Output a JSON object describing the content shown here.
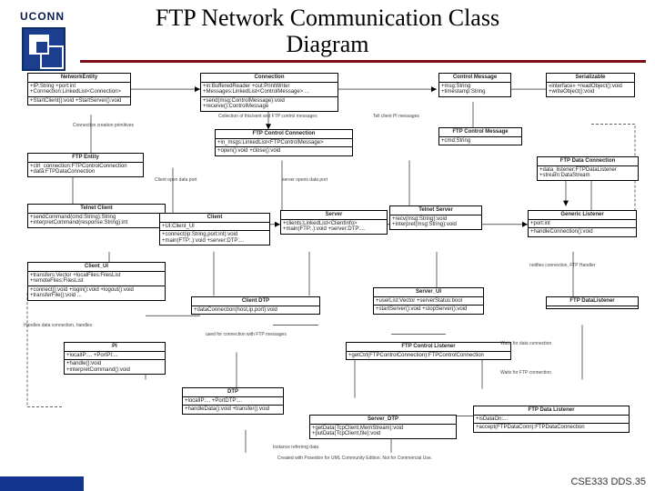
{
  "header": {
    "logo_word": "UCONN",
    "title_l1": "FTP Network Communication Class",
    "title_l2": "Diagram"
  },
  "footer": "CSE333 DDS.35",
  "watermark": "Created with Poseidon for UML Community Edition. Not for Commercial Use.",
  "boxes": {
    "networkentity": {
      "name": "NetworkEntity",
      "a": "+IP:String\n+port:int\n+Connection:LinkedList<Connection>",
      "b": "+StartClient():void\n+StartServer():void"
    },
    "connection": {
      "name": "Connection",
      "a": "+in:BufferedReader\n+out:PrintWriter\n+Messages:LinkedList<ControlMessage>  ...",
      "b": "+send(msg:ControlMessage):void\n+receive():ControlMessage"
    },
    "ctrlmsg": {
      "name": "Control Message",
      "a": "+msg:String\n+timestamp:String"
    },
    "serializable": {
      "name": "Serializable",
      "a": "«interface»\n+readObject():void\n+writeObject():void"
    },
    "ftpentity": {
      "name": "FTP Entity",
      "a": "+ctrl_connection:FTPControlConnection\n+data:FTPDataConnection"
    },
    "ftpcontrolconn": {
      "name": "FTP Control Connection",
      "a": "+in_msgs:LinkedList<FTPControlMessage>",
      "b": "+open():void\n+close():void"
    },
    "ftpctrlmsg": {
      "name": "FTP Control Message",
      "a": "+cmd:String"
    },
    "ftpdataconn": {
      "name": "FTP Data Connection",
      "a": "+data_listener:FTPDataListener\n+stream:DataStream"
    },
    "telnetclient": {
      "name": "Telnet Client",
      "a": "+sendCommand(cmd:String):String\n+interpretCommand(response:String):int"
    },
    "client": {
      "name": "Client",
      "a": "+UI:Client_UI",
      "b": "+connect(ip:String,port:int):void\n+main(FTP:.):void\n+server:DTP:..."
    },
    "server": {
      "name": "Server",
      "a": "+clients:LinkedList<ClientInfo>\n+main(FTP:.):void\n+server:DTP:..."
    },
    "telnetserver": {
      "name": "Telnet Server",
      "a": "+recv(msg:String):void\n+interpret(msg:String):void"
    },
    "genericlistener": {
      "name": "Generic Listener",
      "a": "+port:int",
      "b": "+handleConnection():void"
    },
    "clientui": {
      "name": "Client_UI",
      "a": "+transfers:Vector\n+localFiles:FilesList\n+remoteFiles:FilesList",
      "b": "+connect():void\n+login():void\n+logout():void\n+transferFile():void  ..."
    },
    "clientdtp": {
      "name": "Client DTP",
      "a": "+dataConnection(host,ip,port):void"
    },
    "serverui": {
      "name": "Server_UI",
      "a": "+userList:Vector\n+serverStatus:bool",
      "b": "+startServer():void\n+stopServer():void"
    },
    "ftpctrllistener": {
      "name": "FTP Control Listener",
      "a": "+getCtrl(FTPControlConnection):FTPControlConnection"
    },
    "ftpdatalistener": {
      "name": "FTP DataListener",
      "a": ""
    },
    "pi": {
      "name": "PI",
      "a": "+localIP:...\n+PortPI:...",
      "b": "+handle():void\n+interpretCommand():void"
    },
    "dtp": {
      "name": "DTP",
      "a": "+localIP:...\n+PortDTP:...",
      "b": "+handleData():void\n+transfer():void"
    },
    "serverdtp": {
      "name": "Server_DTP",
      "a": "+getData(TcpClient,MemStream):void\n+putData(TcpClient,file):void"
    },
    "ftpdatacon2": {
      "name": "FTP Data Listener",
      "a": "+isDataOn:...",
      "b": "+accept(FTPDataConn):FTPDataConnection"
    }
  },
  "notes": {
    "n1": "Connection creation primitives",
    "n2": "Collection of this/sent and FTP control messages",
    "n3": "Tell client PI messages",
    "n4": "Client open data port",
    "n5": "server opens data port",
    "n6": "notifies connection, FTP Handler",
    "n7": "Handles data connection, handles",
    "n8": "used for connection with FTP messages",
    "n9": "Waits for data connection",
    "n10": "Waits for FTP connection",
    "n11": "Instance referring data"
  }
}
